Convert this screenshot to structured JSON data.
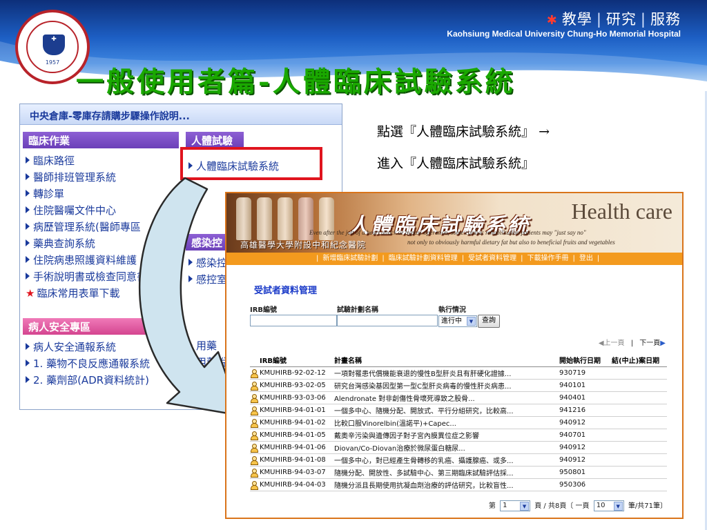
{
  "header": {
    "tagline": [
      "教學",
      "研究",
      "服務"
    ],
    "hospital_en": "Kaohsiung Medical University  Chung-Ho Memorial Hospital",
    "logo_year": "1957",
    "title": "一般使用者篇-人體臨床試驗系統"
  },
  "portal": {
    "header": "中央倉庫-零庫存請購步驟操作說明...",
    "col1": {
      "cat1": "臨床作業",
      "cat1_links": [
        "臨床路徑",
        "醫師排班管理系統",
        "轉診單",
        "住院醫囑文件中心",
        "病歷管理系統(醫師專區",
        "藥典查詢系統",
        "住院病患照護資料維護",
        "手術說明書或檢查同意書",
        "臨床常用表單下載"
      ],
      "cat2": "病人安全專區",
      "cat2_links": [
        "病人安全通報系統",
        "1. 藥物不良反應通報系統",
        "2. 藥劑部(ADR資料統計)"
      ]
    },
    "col2": {
      "cat1": "人體試驗",
      "cat1_links": [
        "人體臨床試驗系統"
      ],
      "cat2": "感染控",
      "cat2_links": [
        "感染控",
        "感控室"
      ],
      "cat3_links": [
        "用藥",
        "用藥說"
      ]
    }
  },
  "instruction": {
    "line1": "點選『人體臨床試驗系統』",
    "line2": "進入『人體臨床試驗系統』",
    "arrow": "→"
  },
  "irb": {
    "banner_title": "人體臨床試驗系統",
    "health_care": "Health care",
    "banner_line1": "Even after the jolt of a heart attack or bypass operation, some cardiac rehabilitation patients may \"just say no\"",
    "banner_line2": "not only to obviously harmful dietary fat but also to beneficial fruits and vegetables",
    "hospital_cn": "高雄醫學大學附設中和紀念醫院",
    "nav": [
      "新增臨床試驗計劃",
      "臨床試驗計劃資料管理",
      "受試者資料管理",
      "下載操作手冊",
      "登出"
    ],
    "section_title": "受試者資料管理",
    "filter": {
      "irb_label": "IRB編號",
      "plan_label": "試驗計劃名稱",
      "status_label": "執行情況",
      "irb_value": "",
      "plan_value": "",
      "status_value": "進行中",
      "button": "查詢"
    },
    "pager_top": {
      "prev": "上一頁",
      "next": "下一頁"
    },
    "table": {
      "headers": [
        "IRB編號",
        "計畫名稱",
        "開始執行日期",
        "結(中止)案日期"
      ],
      "rows": [
        [
          "KMUHIRB-92-02-12",
          "一項對罹患代償機能衰退的慢性B型肝炎且有肝硬化證據...",
          "930719",
          ""
        ],
        [
          "KMUHIRB-93-02-05",
          "研究台灣感染基因型第一型C型肝炎病毒的慢性肝炎病患...",
          "940101",
          ""
        ],
        [
          "KMUHIRB-93-03-06",
          "Alendronate 對非創傷性骨壞死導致之股骨...",
          "940401",
          ""
        ],
        [
          "KMUHIRB-94-01-01",
          "一個多中心、隨機分配、開放式、平行分組研究，比較高...",
          "941216",
          ""
        ],
        [
          "KMUHIRB-94-01-02",
          "比較口服Vinorelbin(溫諾平)+Capec...",
          "940912",
          ""
        ],
        [
          "KMUHIRB-94-01-05",
          "戴奧辛污染與遺傳因子對子宮內膜異位症之影響",
          "940701",
          ""
        ],
        [
          "KMUHIRB-94-01-06",
          "Diovan/Co-Diovan治療於微尿蛋白糖尿...",
          "940912",
          ""
        ],
        [
          "KMUHIRB-94-01-08",
          "一個多中心，對已經產生骨轉移的乳癌、攝護腺癌、或多...",
          "940912",
          ""
        ],
        [
          "KMUHIRB-94-03-07",
          "隨機分配、開放性、多試驗中心、第三期臨床試驗評估採...",
          "950801",
          ""
        ],
        [
          "KMUHIRB-94-04-03",
          "隨機分派且長期使用抗凝血劑治療的評估研究，比較盲性...",
          "950306",
          ""
        ]
      ]
    },
    "pager_bottom": {
      "page_prefix": "第",
      "page_value": "1",
      "page_mid": "頁 / 共8頁〔 一頁",
      "per_page_value": "10",
      "suffix": "筆/共71筆〕"
    }
  },
  "colors": {
    "accent_green": "#1aa800",
    "irb_orange": "#f39a1e",
    "link_blue": "#1a3a9c",
    "highlight_red": "#e0141e"
  }
}
